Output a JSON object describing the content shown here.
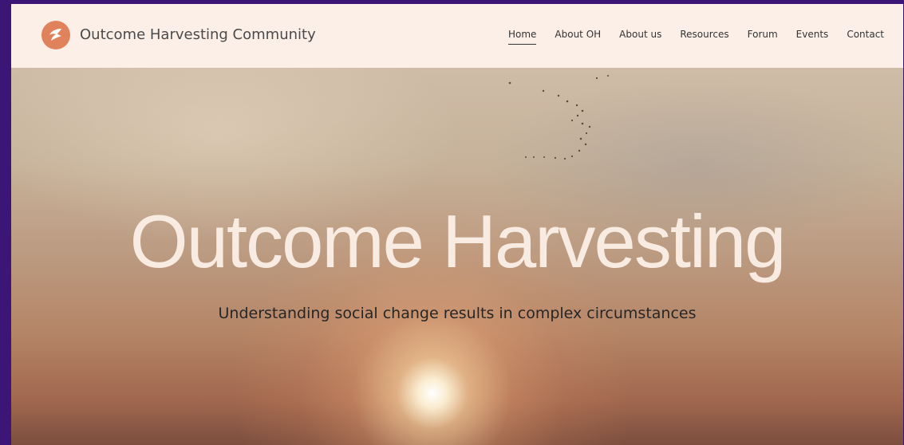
{
  "header": {
    "site_title": "Outcome Harvesting Community",
    "logo_icon": "bird-icon",
    "nav": [
      {
        "label": "Home",
        "active": true
      },
      {
        "label": "About OH",
        "active": false
      },
      {
        "label": "About us",
        "active": false
      },
      {
        "label": "Resources",
        "active": false
      },
      {
        "label": "Forum",
        "active": false
      },
      {
        "label": "Events",
        "active": false
      },
      {
        "label": "Contact",
        "active": false
      }
    ]
  },
  "hero": {
    "title": "Outcome Harvesting",
    "subtitle": "Understanding social change results in complex circumstances"
  },
  "colors": {
    "frame_border": "#3c1676",
    "header_bg": "#fcefe8",
    "logo_accent": "#e0825b",
    "hero_title": "#f8ebe2",
    "hero_subtitle": "#262626"
  }
}
